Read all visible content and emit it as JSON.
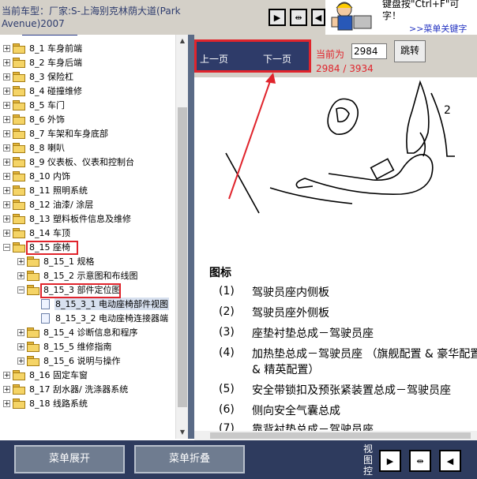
{
  "header": {
    "vehicle_line1": "当前车型：厂家:S-上海别克林荫大道(Park",
    "vehicle_line2": "Avenue)2007",
    "hint_line1": "键盘按\"Ctrl+F\"可",
    "hint_line2": "字！",
    "hint_link": ">>菜单关键字"
  },
  "tree": {
    "items": [
      {
        "label": "8_1 车身前端"
      },
      {
        "label": "8_2 车身后端"
      },
      {
        "label": "8_3 保险杠"
      },
      {
        "label": "8_4 碰撞维修"
      },
      {
        "label": "8_5 车门"
      },
      {
        "label": "8_6 外饰"
      },
      {
        "label": "8_7 车架和车身底部"
      },
      {
        "label": "8_8 喇叭"
      },
      {
        "label": "8_9 仪表板、仪表和控制台"
      },
      {
        "label": "8_10 内饰"
      },
      {
        "label": "8_11 照明系统"
      },
      {
        "label": "8_12 油漆/ 涂层"
      },
      {
        "label": "8_13 塑料板件信息及维修"
      },
      {
        "label": "8_14 车顶"
      },
      {
        "label": "8_15 座椅"
      },
      {
        "label": "8_15_1 规格"
      },
      {
        "label": "8_15_2 示意图和布线图"
      },
      {
        "label": "8_15_3 部件定位图"
      },
      {
        "label": "8_15_3_1 电动座椅部件视图"
      },
      {
        "label": "8_15_3_2 电动座椅连接器端"
      },
      {
        "label": "8_15_4 诊断信息和程序"
      },
      {
        "label": "8_15_5 维修指南"
      },
      {
        "label": "8_15_6 说明与操作"
      },
      {
        "label": "8_16 固定车窗"
      },
      {
        "label": "8_17 刮水器/ 洗涤器系统"
      },
      {
        "label": "8_18 线路系统"
      }
    ]
  },
  "pager": {
    "prev": "上一页",
    "next": "下一页",
    "current_label": "当前为",
    "input_value": "2984",
    "jump": "跳转",
    "count": "2984 / 3934"
  },
  "legend": {
    "title": "图标",
    "items": [
      {
        "num": "(1)",
        "text": "驾驶员座内侧板"
      },
      {
        "num": "(2)",
        "text": "驾驶员座外侧板"
      },
      {
        "num": "(3)",
        "text": "座垫衬垫总成－驾驶员座"
      },
      {
        "num": "(4)",
        "text": "加热垫总成－驾驶员座 （旗舰配置 & 豪华配置 & 精英配置）"
      },
      {
        "num": "(5)",
        "text": "安全带锁扣及预张紧装置总成－驾驶员座"
      },
      {
        "num": "(6)",
        "text": "侧向安全气囊总成"
      },
      {
        "num": "(7)",
        "text": "靠背衬垫总成－驾驶员座"
      }
    ]
  },
  "bottom": {
    "expand": "菜单展开",
    "collapse": "菜单折叠",
    "view_control": "视图控"
  },
  "colors": {
    "highlight_red": "#e0242c",
    "nav_blue": "#2e3b69"
  }
}
